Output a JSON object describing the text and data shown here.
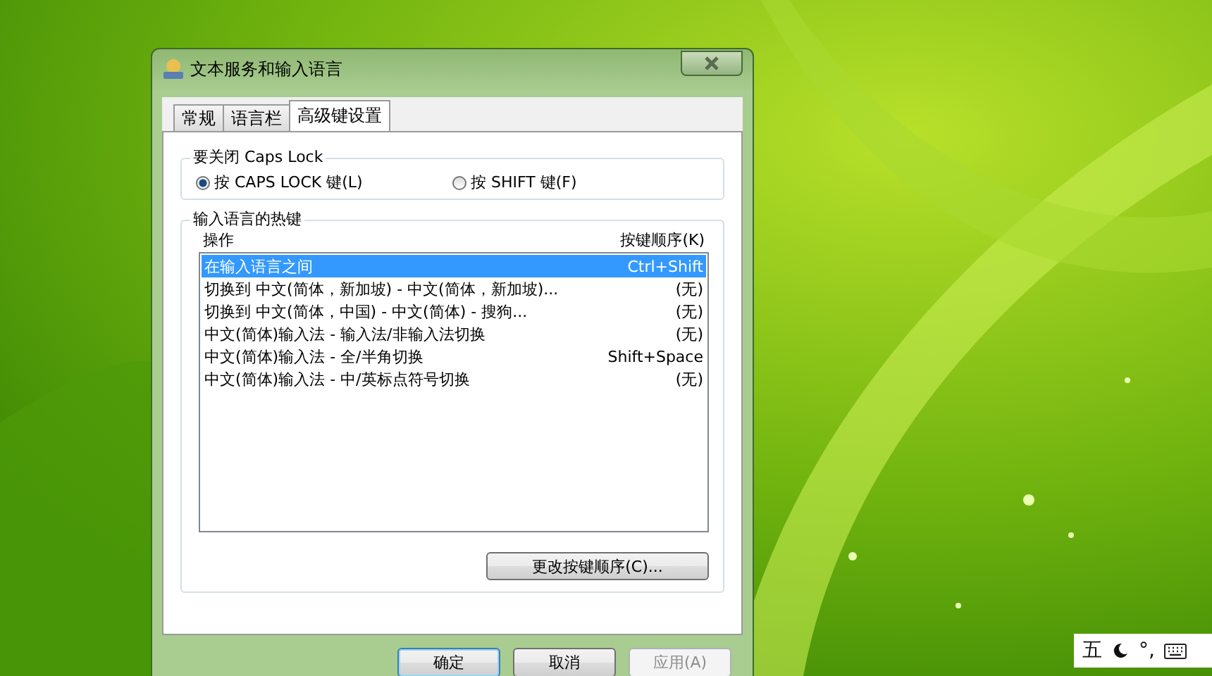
{
  "window": {
    "title": "文本服务和输入语言"
  },
  "tabs": [
    {
      "label": "常规",
      "selected": false
    },
    {
      "label": "语言栏",
      "selected": false
    },
    {
      "label": "高级键设置",
      "selected": true
    }
  ],
  "caps_lock": {
    "title": "要关闭 Caps Lock",
    "options": [
      {
        "label": "按 CAPS LOCK 键(L)",
        "selected": true
      },
      {
        "label": "按 SHIFT 键(F)",
        "selected": false
      }
    ]
  },
  "hotkeys": {
    "title": "输入语言的热键",
    "columns": [
      "操作",
      "按键顺序(K)"
    ],
    "rows": [
      {
        "action": "在输入语言之间",
        "keys": "Ctrl+Shift",
        "selected": true
      },
      {
        "action": "切换到 中文(简体，新加坡) - 中文(简体，新加坡)...",
        "keys": "(无)",
        "selected": false
      },
      {
        "action": "切换到 中文(简体，中国) - 中文(简体) - 搜狗...",
        "keys": "(无)",
        "selected": false
      },
      {
        "action": "中文(简体)输入法 - 输入法/非输入法切换",
        "keys": "(无)",
        "selected": false
      },
      {
        "action": "中文(简体)输入法 - 全/半角切换",
        "keys": "Shift+Space",
        "selected": false
      },
      {
        "action": "中文(简体)输入法 - 中/英标点符号切换",
        "keys": "(无)",
        "selected": false
      }
    ],
    "button": "更改按键顺序(C)..."
  },
  "buttons": [
    {
      "label": "确定",
      "default": true,
      "disabled": false
    },
    {
      "label": "取消",
      "default": false,
      "disabled": false
    },
    {
      "label": "应用(A)",
      "default": false,
      "disabled": true
    }
  ],
  "ime_bar": {
    "items": [
      {
        "kind": "text",
        "text": "五"
      },
      {
        "kind": "moon"
      },
      {
        "kind": "text",
        "text": "°,"
      },
      {
        "kind": "keyboard"
      }
    ]
  }
}
